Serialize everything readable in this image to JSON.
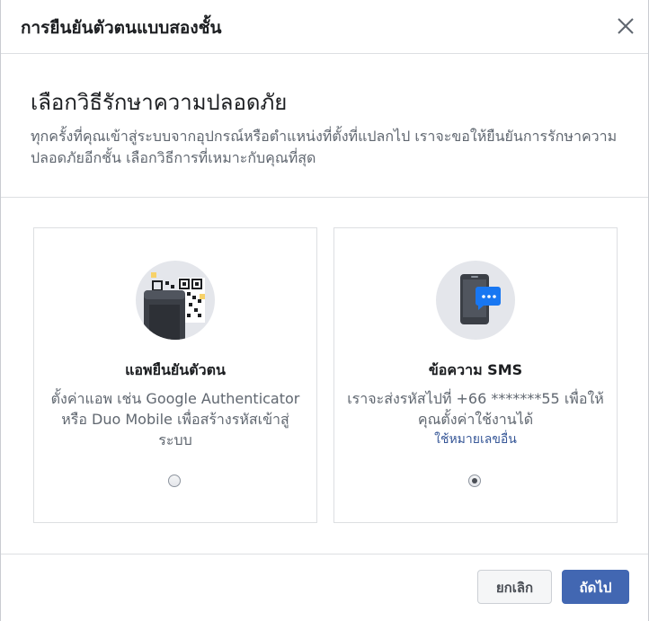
{
  "dialog": {
    "title": "การยืนยันตัวตนแบบสองชั้น",
    "close_icon": "close-icon"
  },
  "intro": {
    "title": "เลือกวิธีรักษาความปลอดภัย",
    "description": "ทุกครั้งที่คุณเข้าสู่ระบบจากอุปกรณ์หรือตำแหน่งที่ตั้งที่แปลกไป เราจะขอให้ยืนยันการรักษาความปลอดภัยอีกชั้น เลือกวิธีการที่เหมาะกับคุณที่สุด"
  },
  "options": [
    {
      "icon": "authenticator-app-icon",
      "title": "แอพยืนยันตัวตน",
      "description": "ตั้งค่าแอพ เช่น Google Authenticator หรือ Duo Mobile เพื่อสร้างรหัสเข้าสู่ระบบ",
      "selected": false
    },
    {
      "icon": "sms-phone-icon",
      "title": "ข้อความ SMS",
      "description": "เราจะส่งรหัสไปที่ +66 *******55 เพื่อให้คุณตั้งค่าใช้งานได้",
      "link": "ใช้หมายเลขอื่น",
      "selected": true
    }
  ],
  "footer": {
    "cancel_label": "ยกเลิก",
    "next_label": "ถัดไป"
  },
  "colors": {
    "primary": "#4267b2",
    "link": "#385898",
    "border": "#dddfe2",
    "secondary_text": "#606770"
  }
}
